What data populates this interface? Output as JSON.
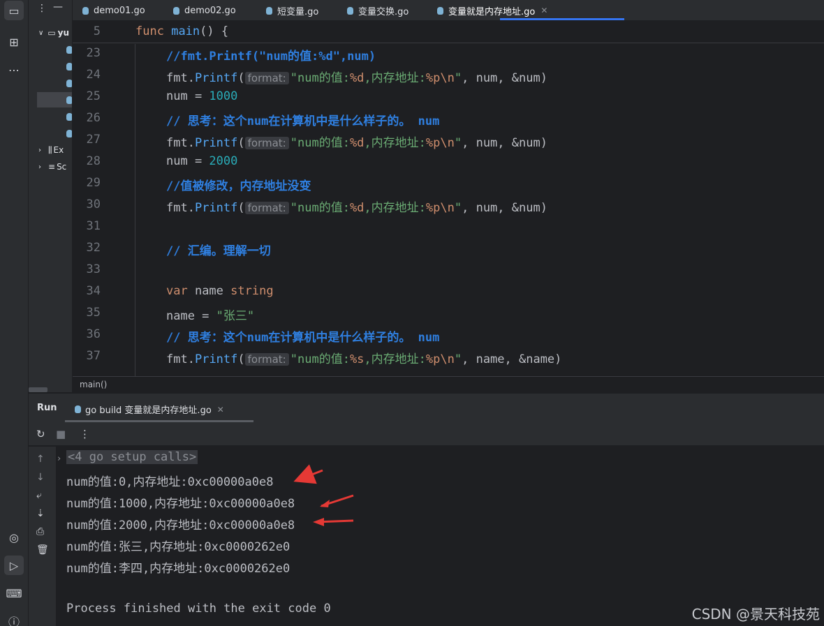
{
  "tabs": [
    {
      "label": "demo01.go",
      "active": false
    },
    {
      "label": "demo02.go",
      "active": false
    },
    {
      "label": "短变量.go",
      "active": false
    },
    {
      "label": "变量交换.go",
      "active": false
    },
    {
      "label": "变量就是内存地址.go",
      "active": true
    }
  ],
  "project": {
    "root_label": "yu",
    "external_label": "Ex",
    "scratches_label": "Sc"
  },
  "editor": {
    "sticky_line": {
      "number": "5",
      "kw": "func",
      "name": "main",
      "rest": "() {"
    },
    "lines": [
      {
        "n": "23"
      },
      {
        "n": "24"
      },
      {
        "n": "25"
      },
      {
        "n": "26"
      },
      {
        "n": "27"
      },
      {
        "n": "28"
      },
      {
        "n": "29"
      },
      {
        "n": "30"
      },
      {
        "n": "31"
      },
      {
        "n": "32"
      },
      {
        "n": "33"
      },
      {
        "n": "34"
      },
      {
        "n": "35"
      },
      {
        "n": "36"
      },
      {
        "n": "37"
      }
    ],
    "tokens": {
      "c23": "//fmt.Printf(\"num的值:%d\",num)",
      "fmt_pkg": "fmt",
      "printf": "Printf",
      "hint": "format:",
      "fmt24_a": "\"num的值:",
      "fmt24_b": "%d",
      "fmt24_c": ",内存地址:",
      "fmt24_d": "%p\\n",
      "fmt24_e": "\"",
      "args_num": ", num, &num)",
      "num_kw": "num = ",
      "v1000": "1000",
      "c26_a": "// 思考：这个num在计算机中是什么样子的。 num",
      "v2000": "2000",
      "c29": "//值被修改，内存地址没变",
      "c32": "// 汇编。理解一切",
      "var_kw": "var",
      "var_rest": " name ",
      "string_kw": "string",
      "name_assign": "name = ",
      "zhangsan": "\"张三\"",
      "fmt37_b": "%s",
      "args_name": ", name, &name)"
    }
  },
  "breadcrumb": "main()",
  "run": {
    "title": "Run",
    "tab_label": "go build 变量就是内存地址.go",
    "output": [
      "<4 go setup calls>",
      "num的值:0,内存地址:0xc00000a0e8",
      "num的值:1000,内存地址:0xc00000a0e8",
      "num的值:2000,内存地址:0xc00000a0e8",
      "num的值:张三,内存地址:0xc0000262e0",
      "num的值:李四,内存地址:0xc0000262e0",
      "",
      "Process finished with the exit code 0"
    ]
  },
  "watermark": "CSDN @景天科技苑",
  "colors": {
    "accent": "#3574f0",
    "keyword": "#cf8e6d",
    "function": "#56a8f5",
    "number": "#2aacb8",
    "string": "#6aab73",
    "comment": "#2f7fe0",
    "arrow": "#e53935"
  }
}
